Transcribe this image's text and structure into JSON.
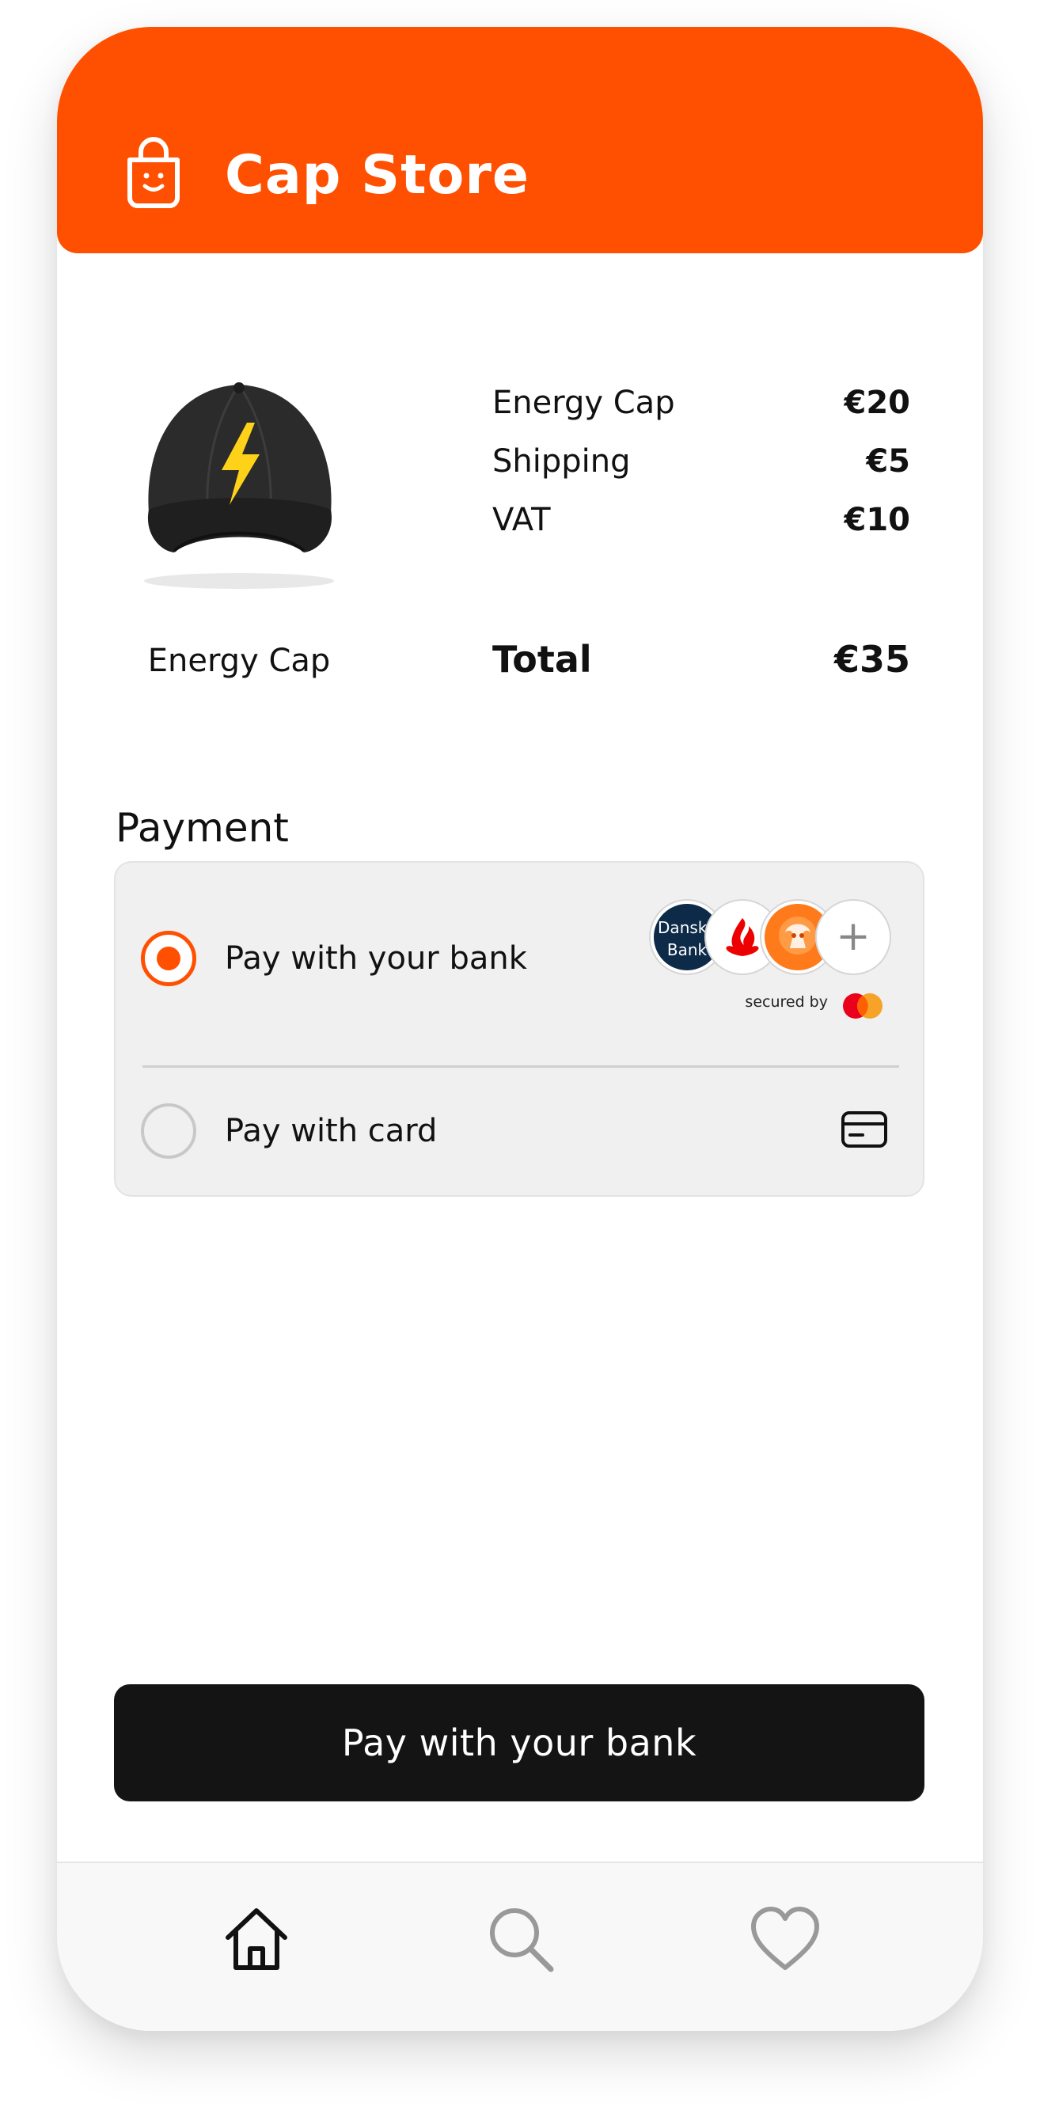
{
  "app": {
    "title": "Cap Store",
    "accent": "#ff5001"
  },
  "product": {
    "name": "Energy Cap",
    "image": "black-cap-lightning-image"
  },
  "summary": {
    "rows": [
      {
        "label": "Energy Cap",
        "amount": "€20"
      },
      {
        "label": "Shipping",
        "amount": "€5"
      },
      {
        "label": "VAT",
        "amount": "€10"
      }
    ],
    "total_label": "Total",
    "total_amount": "€35"
  },
  "payment": {
    "title": "Payment",
    "options": [
      {
        "label": "Pay with your bank",
        "selected": true
      },
      {
        "label": "Pay with card",
        "selected": false
      }
    ],
    "bank_logos": [
      {
        "name": "Danske Bank",
        "line1": "Danske",
        "line2": "Bank"
      },
      {
        "name": "Santander"
      },
      {
        "name": "ING"
      },
      {
        "name": "more",
        "symbol": "+"
      }
    ],
    "secured_by": "secured by"
  },
  "cta": {
    "label": "Pay with your bank"
  },
  "tabbar": {
    "icons": [
      "home-icon",
      "search-icon",
      "heart-icon"
    ]
  }
}
